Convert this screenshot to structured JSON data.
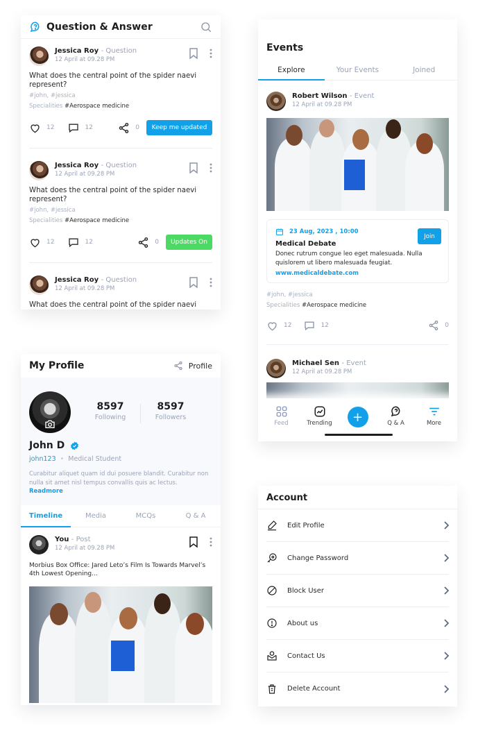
{
  "qa": {
    "title": "Question & Answer",
    "icons": {
      "logo": "question-chat-icon",
      "search": "search-icon"
    },
    "posts": [
      {
        "author": "Jessica Roy",
        "kind": "- Question",
        "time": "12 April at 09.28 PM",
        "text": "What does the central point of the spider naevi represent?",
        "tags": "#john, #jessica",
        "spec_label": "Specialities",
        "spec_value": "#Aerospace medicine",
        "likes": "12",
        "comments": "12",
        "shares": "0",
        "button": "Keep me updated",
        "button_color": "#12a0e8"
      },
      {
        "author": "Jessica Roy",
        "kind": "- Question",
        "time": "12 April at 09.28 PM",
        "text": "What does the central point of the spider naevi represent?",
        "tags": "#john, #jessica",
        "spec_label": "Specialities",
        "spec_value": "#Aerospace medicine",
        "likes": "12",
        "comments": "12",
        "shares": "0",
        "button": "Updates On",
        "button_color": "#4cd964"
      },
      {
        "author": "Jessica Roy",
        "kind": "- Question",
        "time": "12 April at 09.28 PM",
        "text": "What does the central point of the spider naevi"
      }
    ]
  },
  "events": {
    "title": "Events",
    "tabs": [
      {
        "label": "Explore",
        "active": true
      },
      {
        "label": "Your Events",
        "active": false
      },
      {
        "label": "Joined",
        "active": false
      }
    ],
    "post": {
      "author": "Robert Wilson",
      "kind": "- Event",
      "time": "12 April at 09.28 PM",
      "date": "23 Aug, 2023 , 10:00",
      "name": "Medical Debate",
      "desc": "Donec rutrum congue leo eget malesuada. Nulla quislorem ut libero malesuada feugiat.",
      "link": "www.medicaldebate.com",
      "join": "Join",
      "tags": "#john, #jessica",
      "spec_label": "Specialities",
      "spec_value": "#Aerospace medicine",
      "likes": "12",
      "comments": "12",
      "shares": "0"
    },
    "post2": {
      "author": "Michael Sen",
      "kind": "- Event",
      "time": "12 April at 09.28 PM"
    },
    "nav": [
      {
        "label": "Feed",
        "icon": "grid-icon"
      },
      {
        "label": "Trending",
        "icon": "trending-icon"
      },
      {
        "label": "+",
        "icon": "plus-icon"
      },
      {
        "label": "Q & A",
        "icon": "question-chat-icon"
      },
      {
        "label": "More",
        "icon": "filter-icon"
      }
    ]
  },
  "profile": {
    "title": "My Profile",
    "profile_link": "Profile",
    "following_count": "8597",
    "following_label": "Following",
    "followers_count": "8597",
    "followers_label": "Followers",
    "name": "John D",
    "handle": "john123",
    "separator": "•",
    "role": "Medical Student",
    "bio": "Curabitur aliquet quam id dui posuere blandit. Curabitur non nulla sit amet nisl tempus convallis quis ac lectus.",
    "readmore": "Readmore",
    "tabs": [
      {
        "label": "Timeline",
        "active": true
      },
      {
        "label": "Media",
        "active": false
      },
      {
        "label": "MCQs",
        "active": false
      },
      {
        "label": "Q & A",
        "active": false
      }
    ],
    "post": {
      "author": "You",
      "kind": "- Post",
      "time": "12 April at 09.28 PM",
      "text": "Morbius Box Office: Jared Leto’s Film Is Towards Marvel’s 4th Lowest Opening..."
    }
  },
  "account": {
    "title": "Account",
    "items": [
      {
        "label": "Edit Profile",
        "icon": "pencil-icon"
      },
      {
        "label": "Change Password",
        "icon": "key-icon"
      },
      {
        "label": "Block User",
        "icon": "block-icon"
      },
      {
        "label": "About us",
        "icon": "info-icon"
      },
      {
        "label": "Contact Us",
        "icon": "mail-icon"
      },
      {
        "label": "Delete Account",
        "icon": "trash-icon"
      }
    ]
  },
  "colors": {
    "accent": "#12a0e8",
    "success": "#4cd964",
    "muted": "#9aa3b8"
  }
}
